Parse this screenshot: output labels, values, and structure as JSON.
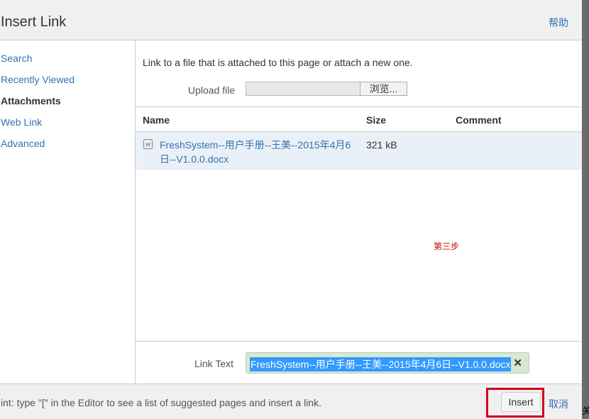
{
  "dialog": {
    "title": "Insert Link",
    "help": "帮助"
  },
  "sidebar": {
    "items": [
      {
        "label": "Search"
      },
      {
        "label": "Recently Viewed"
      },
      {
        "label": "Attachments",
        "active": true
      },
      {
        "label": "Web Link"
      },
      {
        "label": "Advanced"
      }
    ]
  },
  "main": {
    "intro": "Link to a file that is attached to this page or attach a new one.",
    "upload_label": "Upload file",
    "browse_label": "浏览...",
    "columns": [
      "Name",
      "Size",
      "Comment"
    ],
    "rows": [
      {
        "icon": "word-doc-icon",
        "name": "FreshSystem--用户手册--王美--2015年4月6日--V1.0.0.docx",
        "size": "321 kB",
        "comment": ""
      }
    ],
    "annotation": "第三步",
    "link_text_label": "Link Text",
    "link_text_value": "FreshSystem--用户手册--王美--2015年4月6日--V1.0.0.docx"
  },
  "footer": {
    "hint": "int: type \"[\" in the Editor to see a list of suggested pages and insert a link.",
    "insert": "Insert",
    "cancel": "取消",
    "edge_char": "关"
  },
  "colors": {
    "link": "#3572b0",
    "highlight": "#d0021b"
  }
}
